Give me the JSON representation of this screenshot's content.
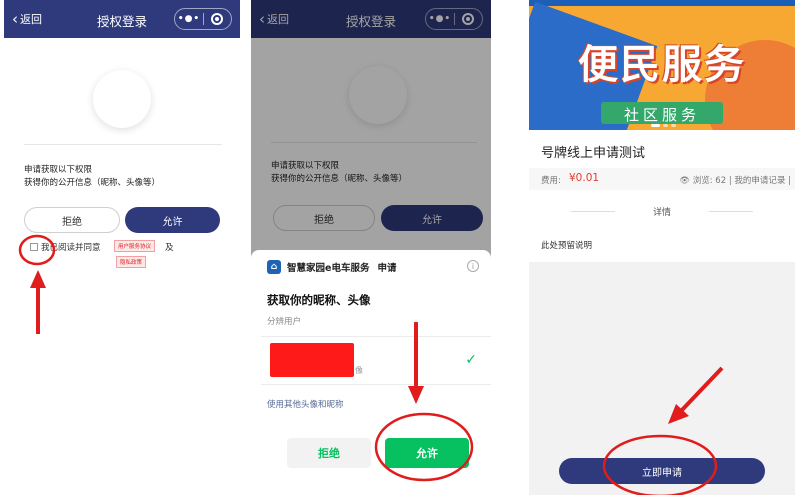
{
  "auth": {
    "back_label": "返回",
    "title": "授权登录",
    "perm_heading": "申请获取以下权限",
    "perm_detail": "获得你的公开信息（昵称、头像等）",
    "reject_label": "拒绝",
    "allow_label": "允许",
    "agree_text": "我已阅读并同意",
    "and_text": "及",
    "user_agreement": "用户服务协议",
    "privacy_policy": "隐私政策"
  },
  "wechat_sheet": {
    "app_name": "智慧家园e电车服务",
    "request_label": "申请",
    "heading": "获取你的昵称、头像",
    "sub": "分辨用户",
    "nickname_suffix": "像",
    "alt_link": "使用其他头像和昵称",
    "reject_label": "拒绝",
    "allow_label": "允许",
    "accent": "#07c160"
  },
  "service": {
    "banner_main": "便民服务",
    "banner_sub": "社区服务",
    "title": "号牌线上申请测试",
    "fee_label": "费用:",
    "price": "¥0.01",
    "views": "浏览: 62",
    "my_records": "我的申请记录",
    "details_heading": "详情",
    "description": "此处预留说明",
    "apply_label": "立即申请"
  },
  "colors": {
    "nav": "#2e3a7c",
    "annotation": "#e01c1c"
  }
}
